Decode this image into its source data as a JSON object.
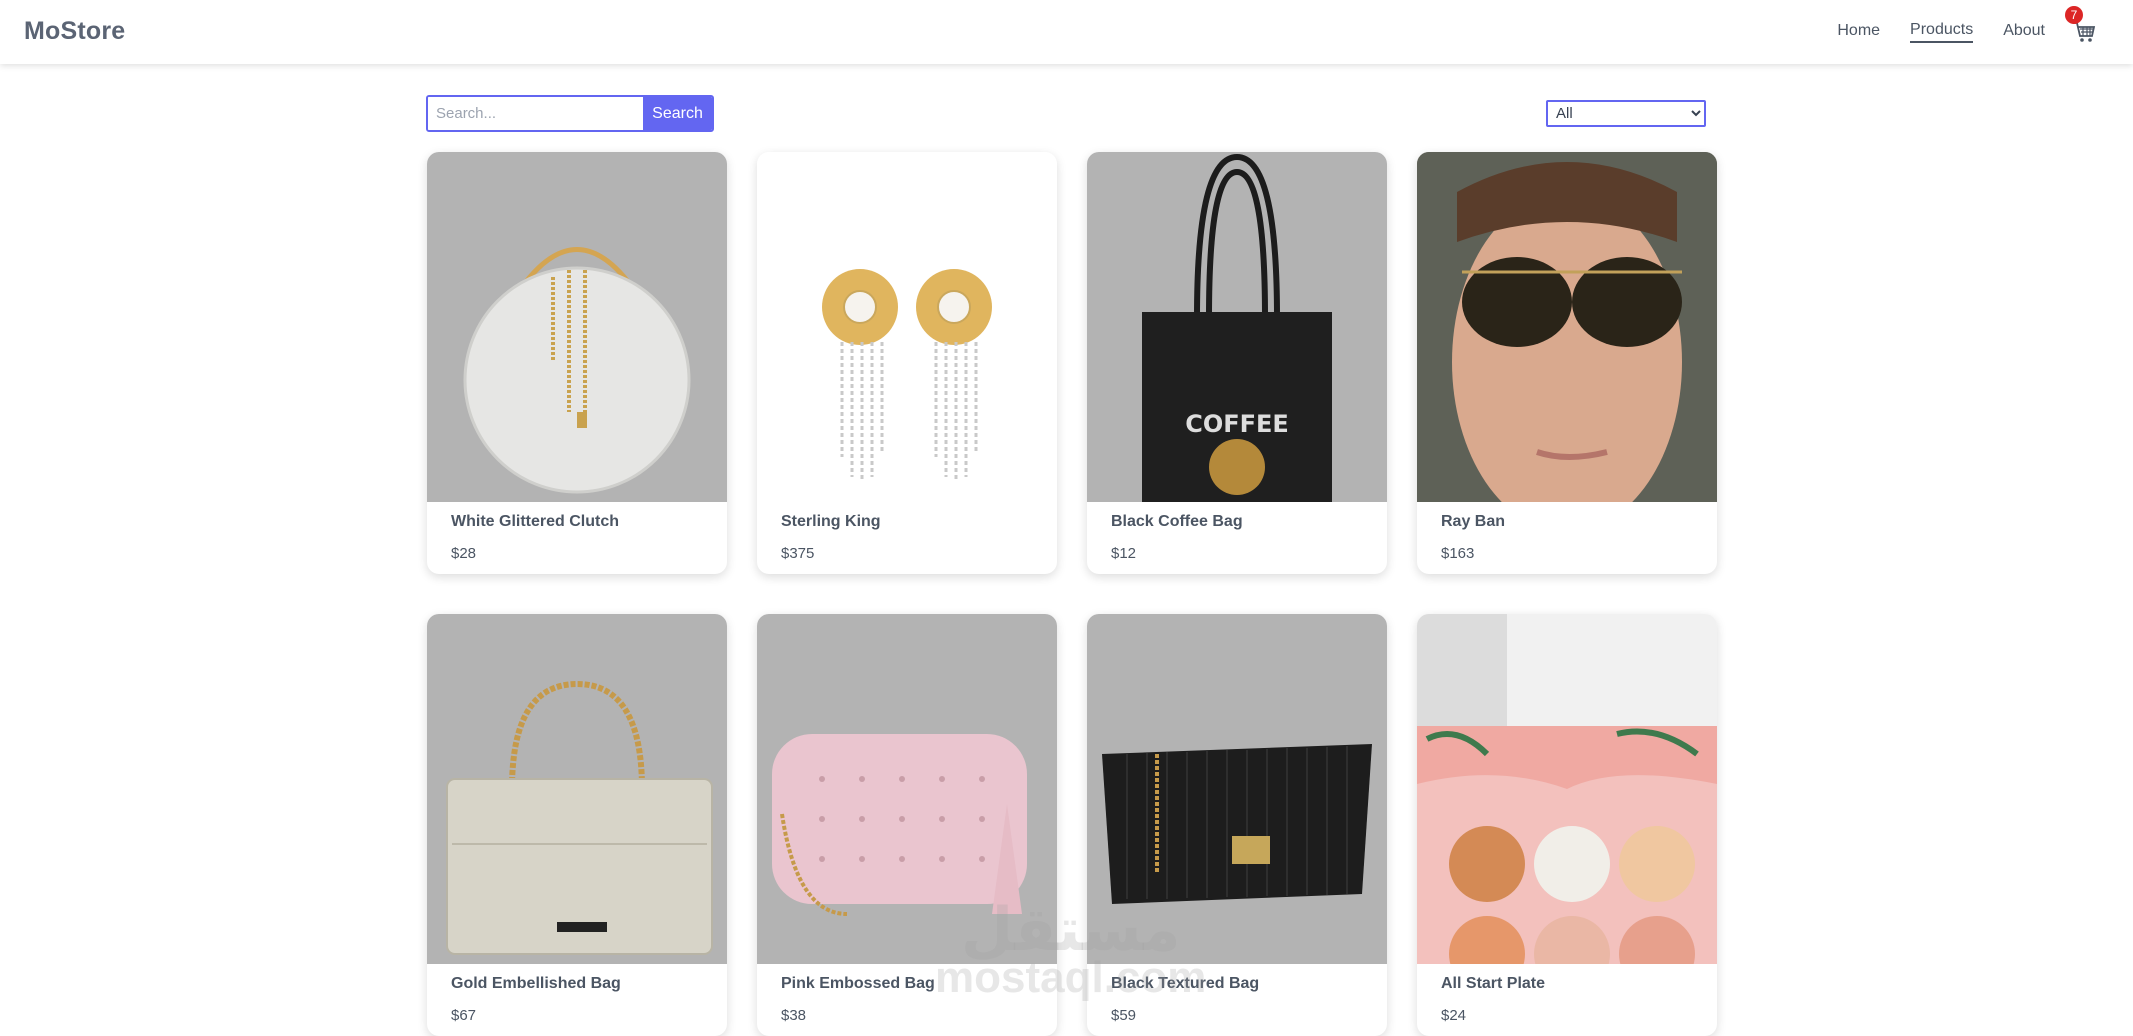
{
  "navbar": {
    "brand": "MoStore",
    "links": [
      {
        "label": "Home",
        "active": false
      },
      {
        "label": "Products",
        "active": true
      },
      {
        "label": "About",
        "active": false
      }
    ],
    "cart_count": "7",
    "cart_icon": "cart-icon"
  },
  "toolbar": {
    "search_placeholder": "Search...",
    "search_button": "Search",
    "category_selected": "All"
  },
  "products": [
    {
      "name": "White Glittered Clutch",
      "price": "$28"
    },
    {
      "name": "Sterling King",
      "price": "$375"
    },
    {
      "name": "Black Coffee Bag",
      "price": "$12"
    },
    {
      "name": "Ray Ban",
      "price": "$163"
    },
    {
      "name": "Gold Embellished Bag",
      "price": "$67"
    },
    {
      "name": "Pink Embossed Bag",
      "price": "$38"
    },
    {
      "name": "Black Textured Bag",
      "price": "$59"
    },
    {
      "name": "All Start Plate",
      "price": "$24"
    }
  ],
  "watermark": {
    "arabic": "مستقل",
    "latin": "mostaql.com"
  },
  "colors": {
    "accent": "#6366f1",
    "badge": "#dc2626",
    "text": "#4b5563"
  }
}
